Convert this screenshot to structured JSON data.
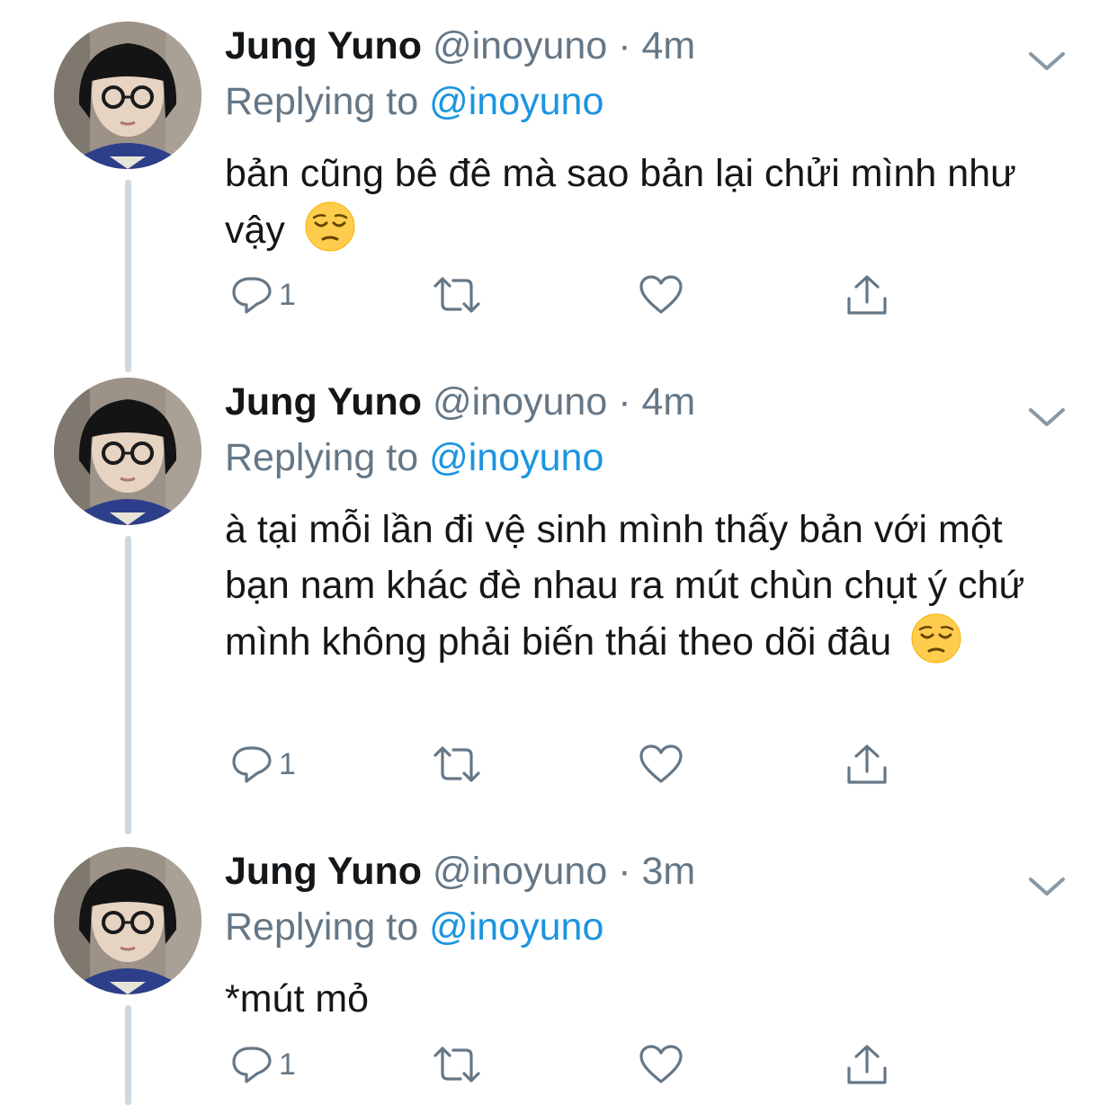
{
  "tweets": [
    {
      "name": "Jung Yuno",
      "handle": "@inoyuno",
      "dot": "·",
      "time": "4m",
      "replying_prefix": "Replying to ",
      "replying_mention": "@inoyuno",
      "text": "bản cũng bê đê mà sao bản lại chửi mình như vậy",
      "emoji": "pensive-face",
      "reply_count": "1"
    },
    {
      "name": "Jung Yuno",
      "handle": "@inoyuno",
      "dot": "·",
      "time": "4m",
      "replying_prefix": "Replying to ",
      "replying_mention": "@inoyuno",
      "text": "à tại mỗi lần đi vệ sinh mình thấy bản với một bạn nam khác đè nhau ra mút chùn chụt ý chứ mình không phải biến thái theo dõi đâu",
      "emoji": "pensive-face",
      "reply_count": "1"
    },
    {
      "name": "Jung Yuno",
      "handle": "@inoyuno",
      "dot": "·",
      "time": "3m",
      "replying_prefix": "Replying to ",
      "replying_mention": "@inoyuno",
      "text": "*mút mỏ",
      "reply_count": "1"
    }
  ],
  "colors": {
    "name": "#14171a",
    "secondary": "#657786",
    "link": "#1b95e0",
    "thread_line": "#cfd8df"
  },
  "icons": {
    "reply": "reply-icon",
    "retweet": "retweet-icon",
    "like": "heart-icon",
    "share": "share-icon",
    "more": "chevron-down-icon"
  }
}
